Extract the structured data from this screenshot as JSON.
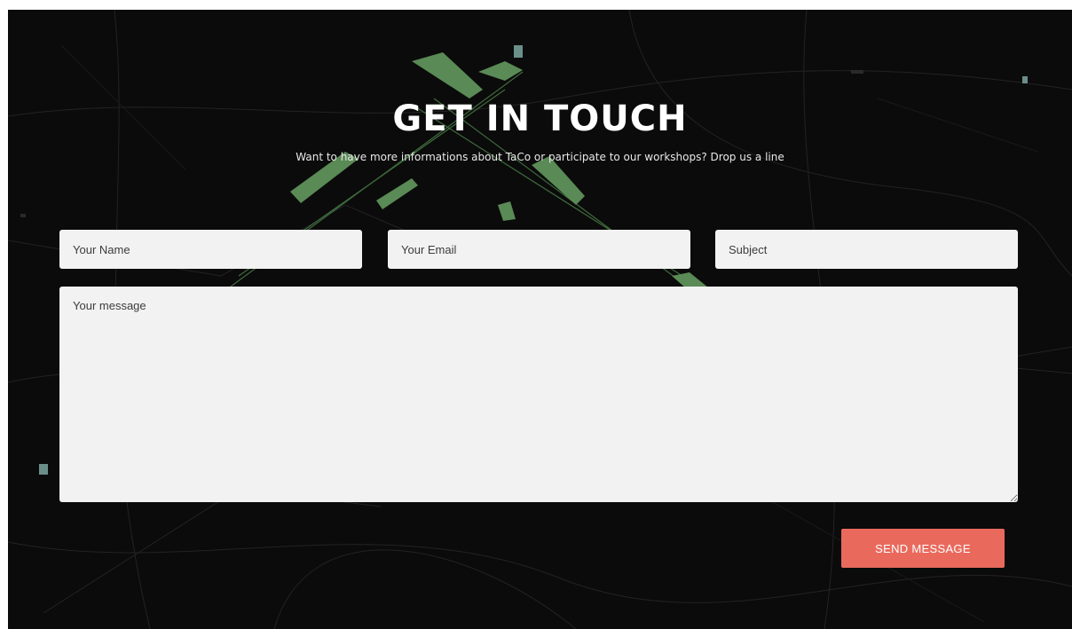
{
  "section": {
    "title": "GET IN TOUCH",
    "subtitle": "Want to have more informations about TaCo or participate to our workshops? Drop us a line"
  },
  "form": {
    "name_placeholder": "Your Name",
    "email_placeholder": "Your Email",
    "subject_placeholder": "Subject",
    "message_placeholder": "Your message",
    "submit_label": "SEND MESSAGE"
  },
  "colors": {
    "background": "#0b0b0b",
    "map_green": "#4f7f4c",
    "field_bg": "#f2f2f2",
    "button": "#e96a5d"
  }
}
